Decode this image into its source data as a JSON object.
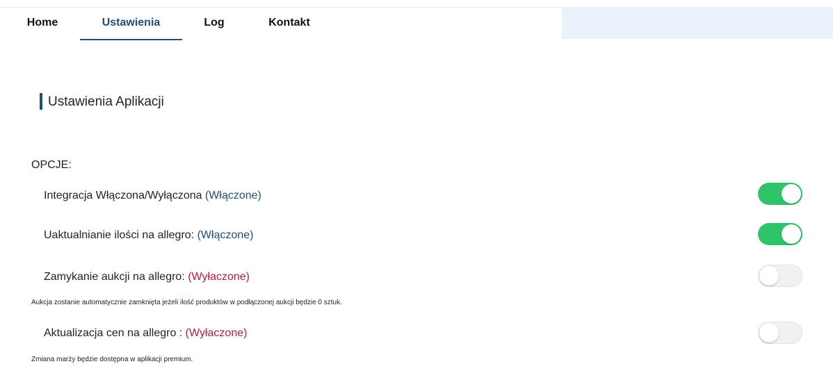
{
  "nav": {
    "items": [
      {
        "label": "Home"
      },
      {
        "label": "Ustawienia"
      },
      {
        "label": "Log"
      },
      {
        "label": "Kontakt"
      }
    ],
    "active": "Ustawienia"
  },
  "page": {
    "title": "Ustawienia Aplikacji",
    "section_label": "OPCJE:"
  },
  "options": [
    {
      "label": "Integracja Włączona/Wyłączona ",
      "status": "(Włączone)",
      "enabled": true,
      "note": ""
    },
    {
      "label": "Uaktualnianie ilości na allegro: ",
      "status": "(Włączone)",
      "enabled": true,
      "note": ""
    },
    {
      "label": "Zamykanie aukcji na allegro: ",
      "status": "(Wyłaczone)",
      "enabled": false,
      "note": "Aukcja zostanie automatycznie zamknięta jeżeli ilość produktów w podłączonej aukcji będzie 0 sztuk."
    },
    {
      "label": "Aktualizacja cen na allegro : ",
      "status": "(Wyłaczone)",
      "enabled": false,
      "note": "Zmiana marży będzie dostępna w aplikacji premium."
    }
  ],
  "colors": {
    "accent": "#1f4e7a",
    "toggle_on": "#2fc46a",
    "status_on": "#1f4e7a",
    "status_off": "#b0223a"
  }
}
